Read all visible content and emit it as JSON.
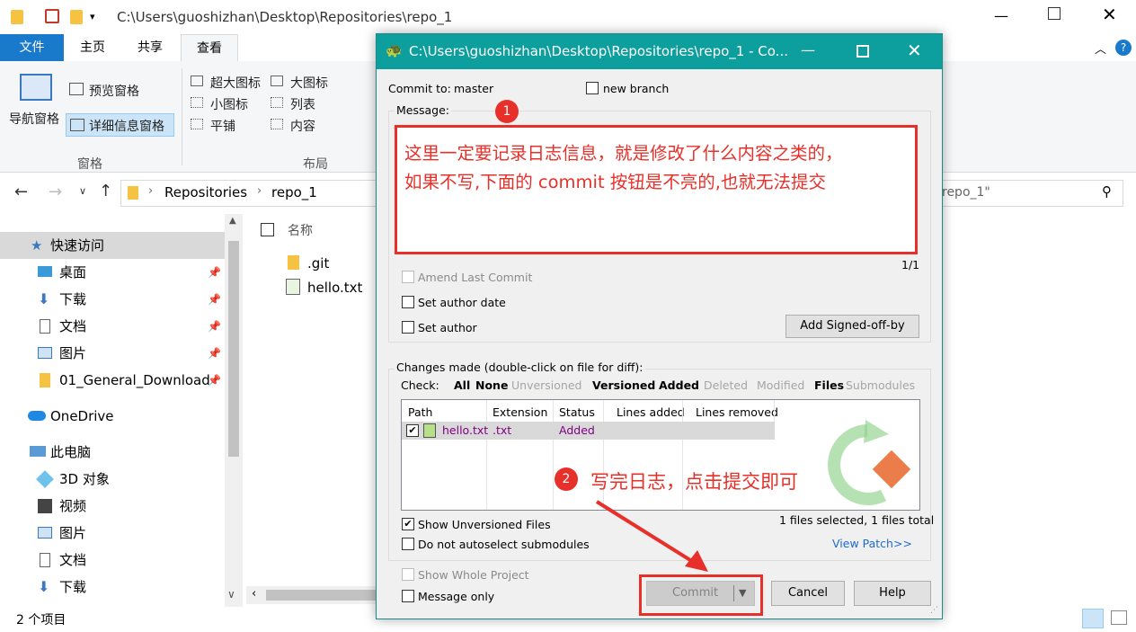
{
  "explorer": {
    "title_path": "C:\\Users\\guoshizhan\\Desktop\\Repositories\\repo_1",
    "tabs": [
      "文件",
      "主页",
      "共享",
      "查看"
    ],
    "ribbon": {
      "nav_pane": "导航窗格",
      "preview_pane": "预览窗格",
      "details_pane": "详细信息窗格",
      "group_panes": "窗格",
      "layout_items": [
        "超大图标",
        "大图标",
        "小图标",
        "列表",
        "平铺",
        "内容"
      ],
      "group_layout": "布局"
    },
    "breadcrumb": [
      "Repositories",
      "repo_1"
    ],
    "search_partial": "repo_1\"",
    "nav_items": [
      "快速访问",
      "桌面",
      "下载",
      "文档",
      "图片",
      "01_General_Download",
      "OneDrive",
      "此电脑",
      "3D 对象",
      "视频",
      "图片",
      "文档",
      "下载"
    ],
    "column_name": "名称",
    "files": [
      ".git",
      "hello.txt"
    ],
    "status_text": "2 个项目"
  },
  "dialog": {
    "title": "C:\\Users\\guoshizhan\\Desktop\\Repositories\\repo_1 - Co...",
    "commit_to_label": "Commit to:",
    "branch": "master",
    "new_branch": "new branch",
    "message_label": "Message:",
    "annotation_1": "这里一定要记录日志信息，就是修改了什么内容之类的，",
    "annotation_1b": "如果不写,下面的 commit 按钮是不亮的,也就无法提交",
    "counter": "1/1",
    "amend": "Amend Last Commit",
    "set_author_date": "Set author date",
    "set_author": "Set author",
    "signed_off": "Add Signed-off-by",
    "changes_label": "Changes made (double-click on file for diff):",
    "check_label": "Check:",
    "filters": [
      "All",
      "None",
      "Unversioned",
      "Versioned",
      "Added",
      "Deleted",
      "Modified",
      "Files",
      "Submodules"
    ],
    "columns": [
      "Path",
      "Extension",
      "Status",
      "Lines added",
      "Lines removed"
    ],
    "row": {
      "path": "hello.txt",
      "ext": ".txt",
      "status": "Added"
    },
    "annotation_2": "写完日志，点击提交即可",
    "badge_1": "1",
    "badge_2": "2",
    "show_unversioned": "Show Unversioned Files",
    "no_autoselect": "Do not autoselect submodules",
    "files_selected": "1 files selected, 1 files total",
    "view_patch": "View Patch>>",
    "show_whole": "Show Whole Project",
    "message_only": "Message only",
    "commit_btn": "Commit",
    "cancel_btn": "Cancel",
    "help_btn": "Help"
  },
  "colors": {
    "accent": "#0d9e9e",
    "annotation": "#e8302a",
    "file_tab": "#1979ca"
  }
}
